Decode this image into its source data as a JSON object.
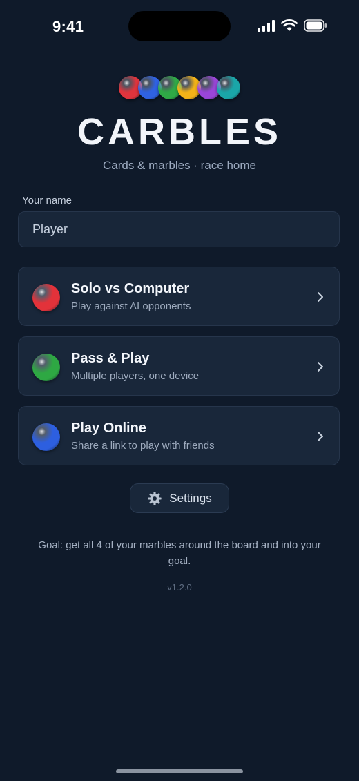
{
  "status_bar": {
    "time": "9:41",
    "icons": [
      "cellular-signal-icon",
      "wifi-icon",
      "battery-icon"
    ]
  },
  "header": {
    "marbles": [
      "#e0343d",
      "#2f62e3",
      "#2faa46",
      "#f2b218",
      "#9a45d8",
      "#1aa6a8"
    ],
    "title": "CARBLES",
    "subtitle": "Cards & marbles · race home"
  },
  "name_field": {
    "label": "Your name",
    "placeholder": "Player",
    "value": ""
  },
  "modes": [
    {
      "title": "Solo vs Computer",
      "description": "Play against AI opponents",
      "marble_color": "#e3323a",
      "icon": "chevron-right-icon"
    },
    {
      "title": "Pass & Play",
      "description": "Multiple players, one device",
      "marble_color": "#2ea843",
      "icon": "chevron-right-icon"
    },
    {
      "title": "Play Online",
      "description": "Share a link to play with friends",
      "marble_color": "#2d5fe0",
      "icon": "chevron-right-icon"
    }
  ],
  "settings": {
    "label": "Settings",
    "icon": "gear-icon"
  },
  "goal_text": "Goal: get all 4 of your marbles around the board and into your goal.",
  "version": "v1.2.0",
  "theme": {
    "background": "#0f1a2a",
    "card": "#19273a",
    "border": "#26354b"
  }
}
